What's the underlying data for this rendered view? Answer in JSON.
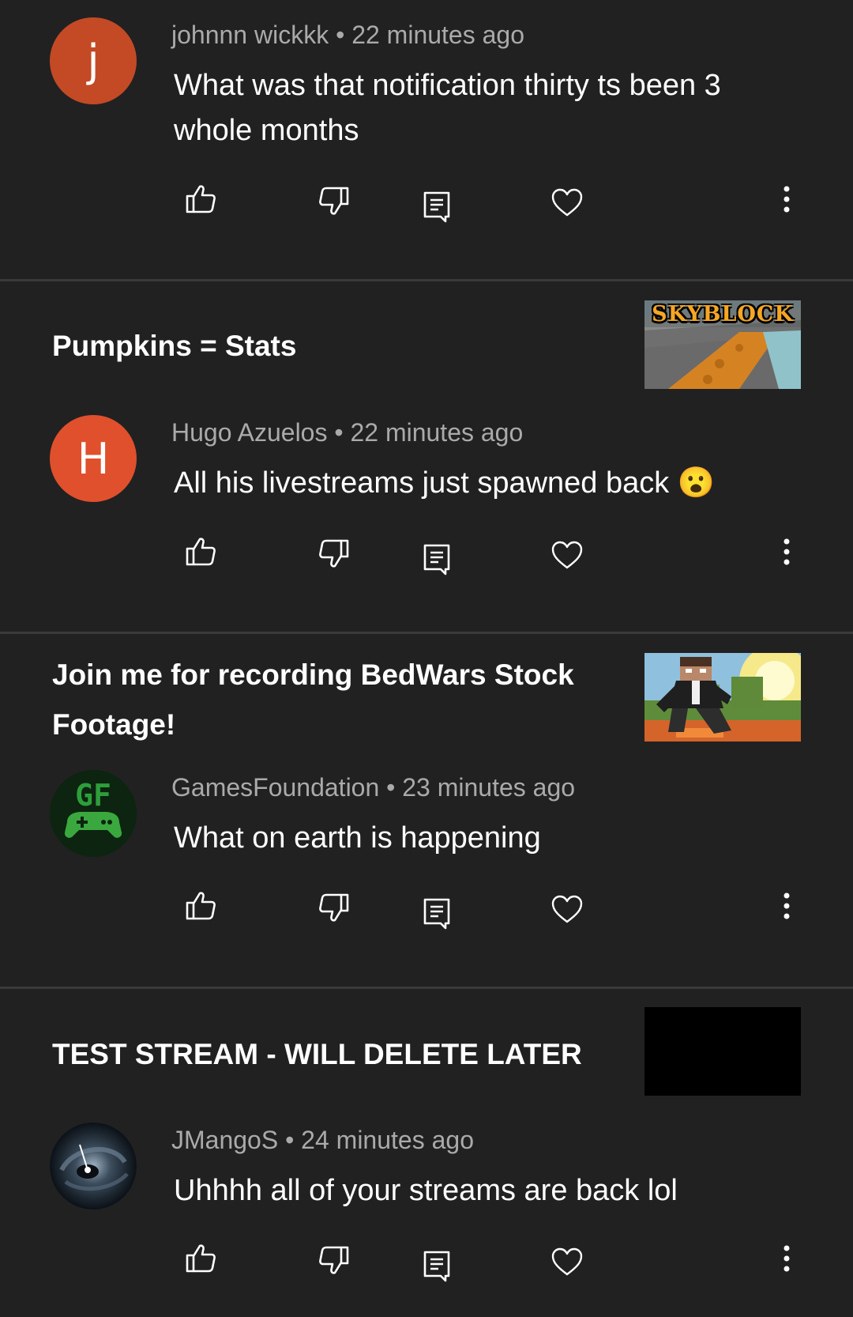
{
  "comments": [
    {
      "author": "johnnn wickkk",
      "time": "22 minutes ago",
      "text": "What was that notification thirty ts been 3 whole months",
      "avatar_letter": "j",
      "avatar_color": "#c34a25"
    },
    {
      "video_title": "Pumpkins = Stats",
      "thumb_text": "SKYBLOCK",
      "author": "Hugo Azuelos",
      "time": "22 minutes ago",
      "text": "All his livestreams just spawned back 😮",
      "avatar_letter": "H",
      "avatar_color": "#e0502c"
    },
    {
      "video_title": "Join me for recording BedWars Stock Footage!",
      "author": "GamesFoundation",
      "time": "23 minutes ago",
      "text": "What on earth is happening",
      "avatar_letter": "GF",
      "avatar_color": "#0c2410"
    },
    {
      "video_title": "TEST STREAM - WILL DELETE LATER",
      "author": "JMangoS",
      "time": "24 minutes ago",
      "text": "Uhhhh all of your streams are back lol"
    }
  ],
  "separator": "•",
  "icons": [
    "like-icon",
    "dislike-icon",
    "reply-icon",
    "heart-icon",
    "more-vert-icon"
  ]
}
